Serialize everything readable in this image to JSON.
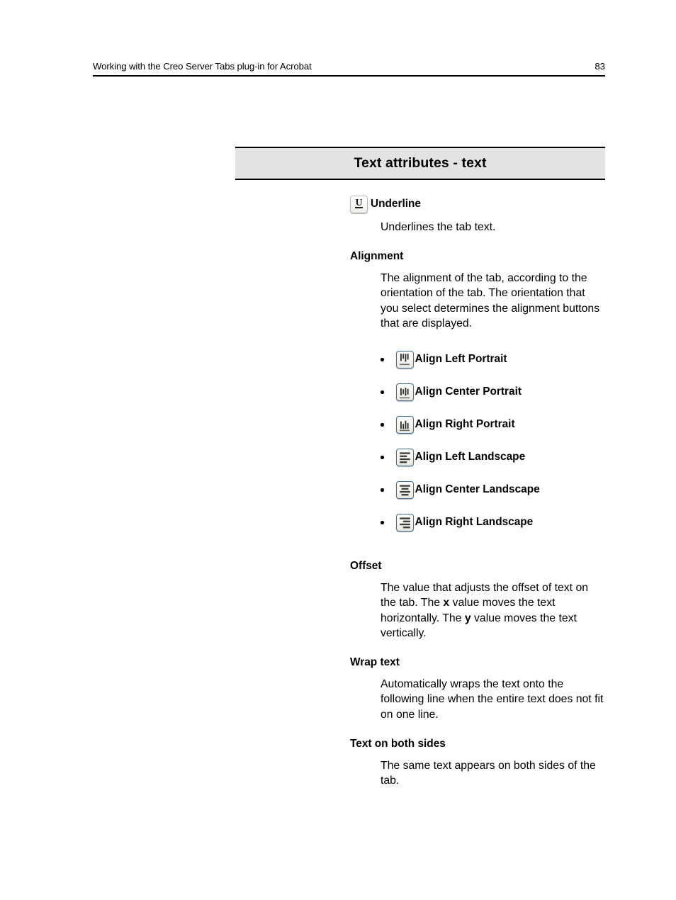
{
  "page_header": {
    "title": "Working with the Creo Server Tabs plug-in for Acrobat",
    "page_number": "83"
  },
  "section": {
    "title": "Text attributes - text",
    "banner_bg": "#e3e3e3",
    "banner_rule_color": "#000000"
  },
  "entries": [
    {
      "term": "Underline",
      "icon": "underline-icon",
      "description": "Underlines the tab text."
    },
    {
      "term": "Alignment",
      "icon": null,
      "description": "The alignment of the tab, according to the orientation of the tab. The orientation that you select determines the alignment buttons that are displayed."
    },
    {
      "term": "Offset",
      "icon": null,
      "description_parts": [
        {
          "text": "The value that adjusts the offset of text on the tab. The ",
          "bold": false
        },
        {
          "text": "x",
          "bold": true
        },
        {
          "text": " value moves the text horizontally. The ",
          "bold": false
        },
        {
          "text": "y",
          "bold": true
        },
        {
          "text": " value moves the text vertically.",
          "bold": false
        }
      ]
    },
    {
      "term": "Wrap text",
      "icon": null,
      "description": "Automatically wraps the text onto the following line when the entire text does not fit on one line."
    },
    {
      "term": "Text on both sides",
      "icon": null,
      "description": "The same text appears on both sides of the tab."
    }
  ],
  "alignment_buttons": [
    {
      "label": "Align Left Portrait",
      "icon": "align-left-portrait-icon"
    },
    {
      "label": "Align Center Portrait",
      "icon": "align-center-portrait-icon"
    },
    {
      "label": "Align Right Portrait",
      "icon": "align-right-portrait-icon"
    },
    {
      "label": "Align Left Landscape",
      "icon": "align-left-landscape-icon"
    },
    {
      "label": "Align Center Landscape",
      "icon": "align-center-landscape-icon"
    },
    {
      "label": "Align Right Landscape",
      "icon": "align-right-landscape-icon"
    }
  ],
  "offset_text": {
    "part1": "The value that adjusts the offset of text on the tab. The ",
    "x": "x",
    "part2": " value moves the text horizontally. The ",
    "y": "y",
    "part3": " value moves the text vertically."
  }
}
